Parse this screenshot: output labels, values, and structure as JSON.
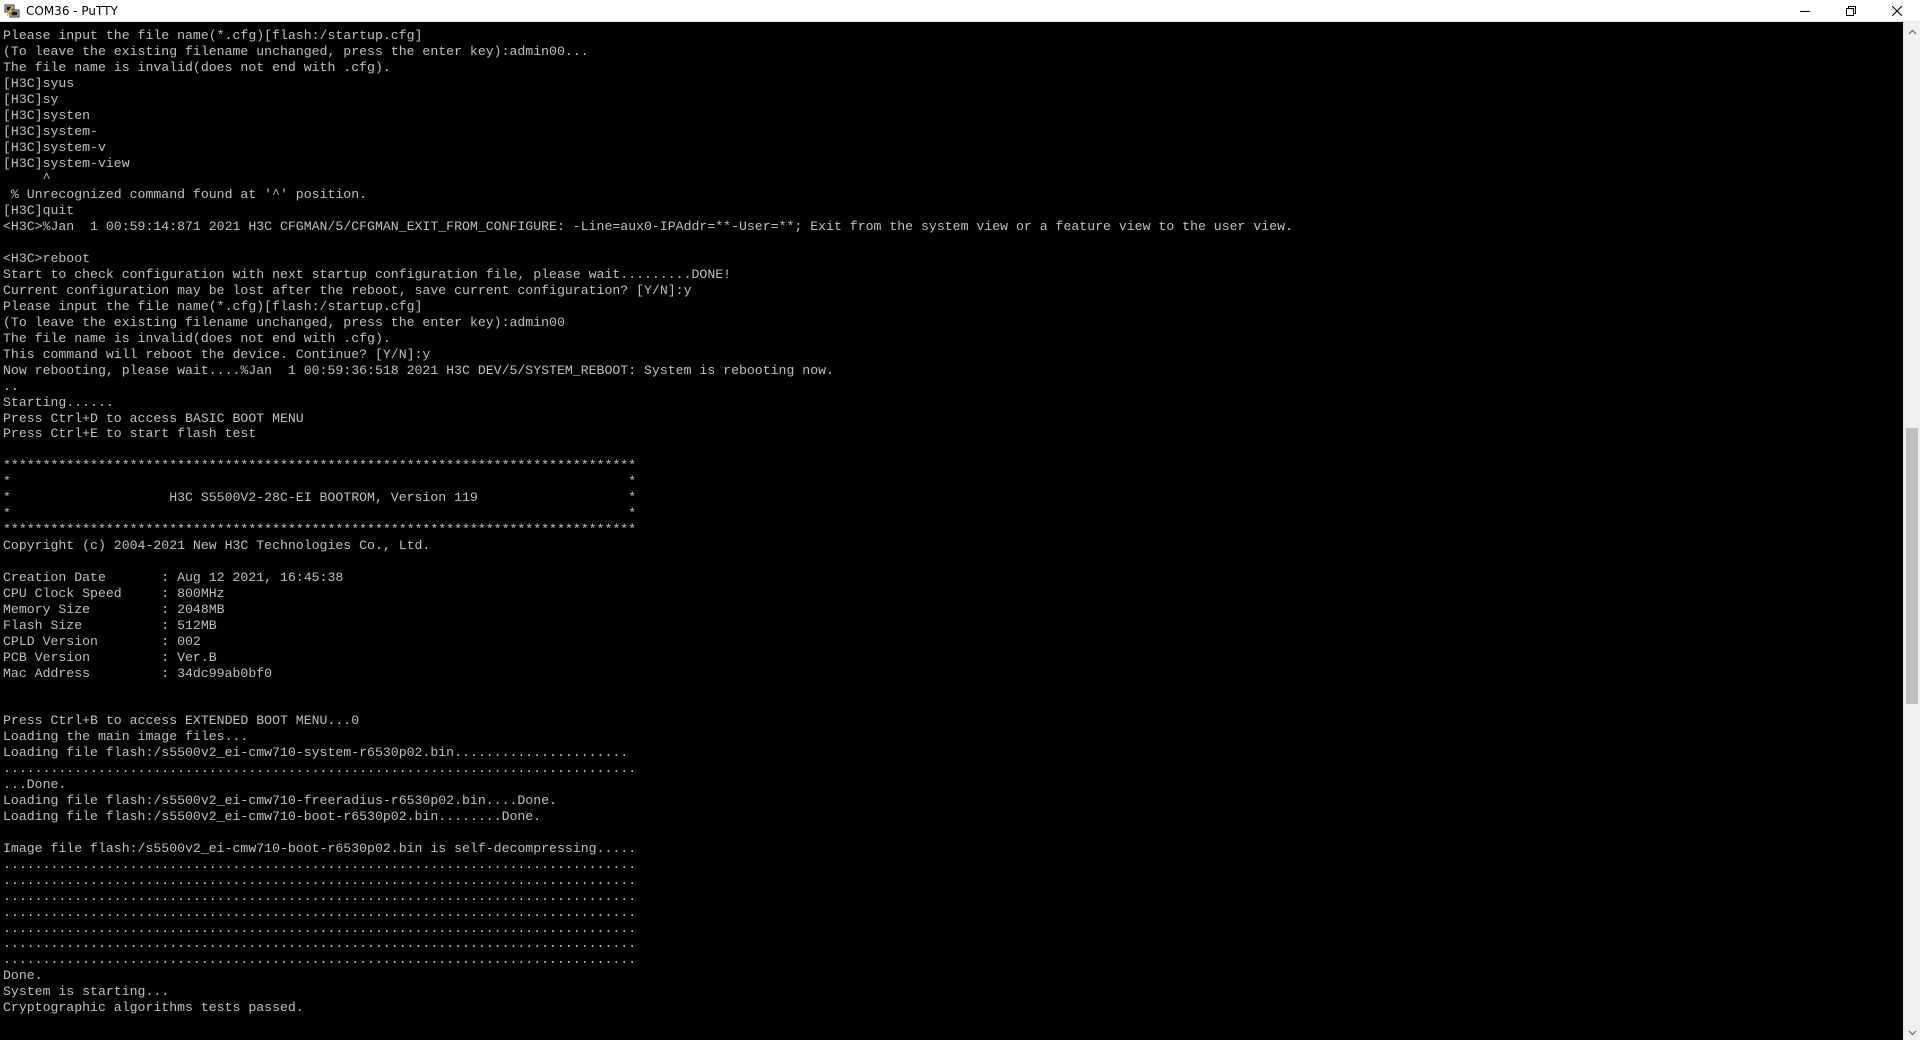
{
  "window": {
    "title": "COM36 - PuTTY",
    "icons": {
      "app": "putty-app-icon",
      "minimize": "minimize-icon",
      "maximize": "restore-icon",
      "close": "close-icon"
    }
  },
  "terminal": {
    "foreground": "#c0c0c0",
    "background": "#000000",
    "lines": [
      "Please input the file name(*.cfg)[flash:/startup.cfg]",
      "(To leave the existing filename unchanged, press the enter key):admin00...",
      "The file name is invalid(does not end with .cfg).",
      "[H3C]syus",
      "[H3C]sy",
      "[H3C]systen",
      "[H3C]system-",
      "[H3C]system-v",
      "[H3C]system-view",
      "     ^",
      " % Unrecognized command found at '^' position.",
      "[H3C]quit",
      "<H3C>%Jan  1 00:59:14:871 2021 H3C CFGMAN/5/CFGMAN_EXIT_FROM_CONFIGURE: -Line=aux0-IPAddr=**-User=**; Exit from the system view or a feature view to the user view.",
      "",
      "<H3C>reboot",
      "Start to check configuration with next startup configuration file, please wait.........DONE!",
      "Current configuration may be lost after the reboot, save current configuration? [Y/N]:y",
      "Please input the file name(*.cfg)[flash:/startup.cfg]",
      "(To leave the existing filename unchanged, press the enter key):admin00",
      "The file name is invalid(does not end with .cfg).",
      "This command will reboot the device. Continue? [Y/N]:y",
      "Now rebooting, please wait....%Jan  1 00:59:36:518 2021 H3C DEV/5/SYSTEM_REBOOT: System is rebooting now.",
      "..",
      "Starting......",
      "Press Ctrl+D to access BASIC BOOT MENU",
      "Press Ctrl+E to start flash test",
      "",
      "********************************************************************************",
      "*                                                                              *",
      "*                    H3C S5500V2-28C-EI BOOTROM, Version 119                   *",
      "*                                                                              *",
      "********************************************************************************",
      "Copyright (c) 2004-2021 New H3C Technologies Co., Ltd.",
      "",
      "Creation Date       : Aug 12 2021, 16:45:38",
      "CPU Clock Speed     : 800MHz",
      "Memory Size         : 2048MB",
      "Flash Size          : 512MB",
      "CPLD Version        : 002",
      "PCB Version         : Ver.B",
      "Mac Address         : 34dc99ab0bf0",
      "",
      "",
      "Press Ctrl+B to access EXTENDED BOOT MENU...0",
      "Loading the main image files...",
      "Loading file flash:/s5500v2_ei-cmw710-system-r6530p02.bin......................",
      "................................................................................",
      "...Done.",
      "Loading file flash:/s5500v2_ei-cmw710-freeradius-r6530p02.bin....Done.",
      "Loading file flash:/s5500v2_ei-cmw710-boot-r6530p02.bin........Done.",
      "",
      "Image file flash:/s5500v2_ei-cmw710-boot-r6530p02.bin is self-decompressing.....",
      "................................................................................",
      "................................................................................",
      "................................................................................",
      "................................................................................",
      "................................................................................",
      "................................................................................",
      "................................................................................",
      "Done.",
      "System is starting...",
      "Cryptographic algorithms tests passed."
    ]
  },
  "scrollbar": {
    "position_fraction": 0.55,
    "visible_fraction": 0.28
  }
}
